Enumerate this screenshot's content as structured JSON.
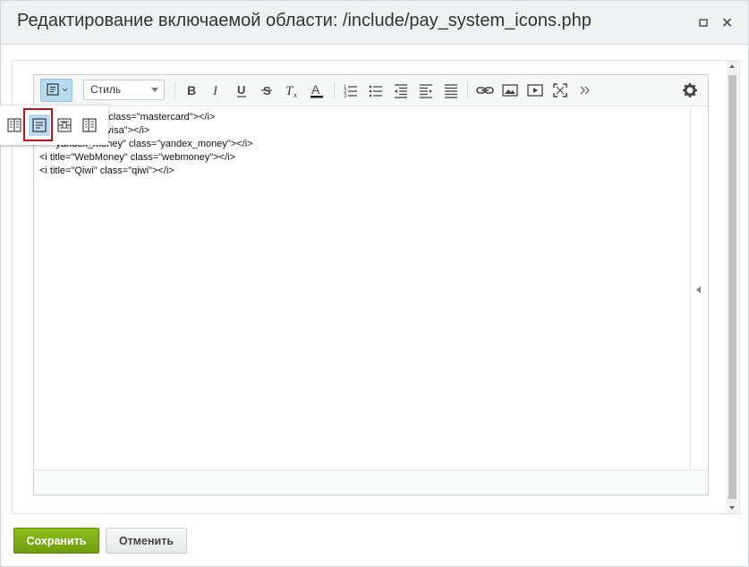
{
  "dialog": {
    "title": "Редактирование включаемой области: /include/pay_system_icons.php",
    "minimize_icon": "maximize-icon",
    "close_icon": "close-icon"
  },
  "toolbar": {
    "style_label": "Стиль",
    "buttons": [
      "bold-icon",
      "italic-icon",
      "underline-icon",
      "strikethrough-icon",
      "remove-format-icon",
      "font-color-icon",
      "ordered-list-icon",
      "unordered-list-icon",
      "outdent-icon",
      "indent-icon",
      "justify-icon",
      "link-icon",
      "image-icon",
      "video-icon",
      "fullscreen-icon",
      "more-icon",
      "settings-icon"
    ]
  },
  "code": {
    "lines": [
      "<i title=\"MasterCard\" class=\"mastercard\"></i>",
      "<i title=\"Visa\" class=\"visa\"></i>",
      "<i title=\"yandex_money\" class=\"yandex_money\"></i>",
      "<i title=\"WebMoney\" class=\"webmoney\"></i>",
      "<i title=\"Qiwi\" class=\"qiwi\"></i>"
    ],
    "visible": [
      "            erCard\" class=\"mastercard\"></i>",
      "             class=\"visa\"></i>",
      "      yandex_money\" class=\"yandex_money\"></i>",
      "<i title=\"WebMoney\" class=\"webmoney\"></i>",
      "<i title=\"Qiwi\" class=\"qiwi\"></i>"
    ]
  },
  "view_mode_popup": {
    "options": [
      "split-vertical-icon",
      "code-view-icon",
      "split-horizontal-icon",
      "wysiwyg-view-icon"
    ],
    "selected": "code-view-icon"
  },
  "footer": {
    "save_label": "Сохранить",
    "cancel_label": "Отменить"
  },
  "colors": {
    "save_button": "#7aab15",
    "highlight_border": "#c0131b",
    "active_button": "#b9dbf1"
  }
}
